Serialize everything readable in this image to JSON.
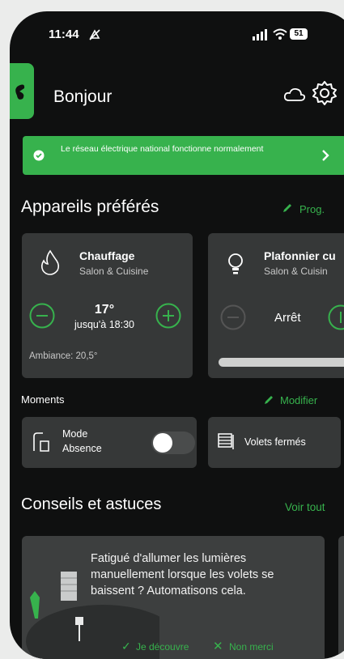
{
  "status_bar": {
    "time": "11:44",
    "battery": "51"
  },
  "header": {
    "greeting": "Bonjour"
  },
  "banner": {
    "text": "Le réseau électrique national fonctionne normalement"
  },
  "favorites": {
    "title": "Appareils préférés",
    "action_label": "Prog.",
    "heating": {
      "name": "Chauffage",
      "room": "Salon & Cuisine",
      "temperature": "17°",
      "until": "jusqu'à 18:30",
      "ambient": "Ambiance: 20,5°"
    },
    "light": {
      "name": "Plafonnier cu",
      "room": "Salon & Cuisin",
      "state": "Arrêt"
    }
  },
  "moments": {
    "title": "Moments",
    "action_label": "Modifier",
    "items": [
      {
        "label_line1": "Mode",
        "label_line2": "Absence",
        "toggle": false
      },
      {
        "label": "Volets fermés"
      }
    ]
  },
  "tips": {
    "title": "Conseils et astuces",
    "see_all": "Voir tout",
    "card": {
      "text": "Fatigué d'allumer les lumières manuellement lorsque les volets se baissent ? Automatisons cela.",
      "accept": "Je découvre",
      "decline": "Non merci"
    }
  },
  "colors": {
    "accent": "#37b24d",
    "card": "#363838",
    "background": "#0f1010"
  }
}
